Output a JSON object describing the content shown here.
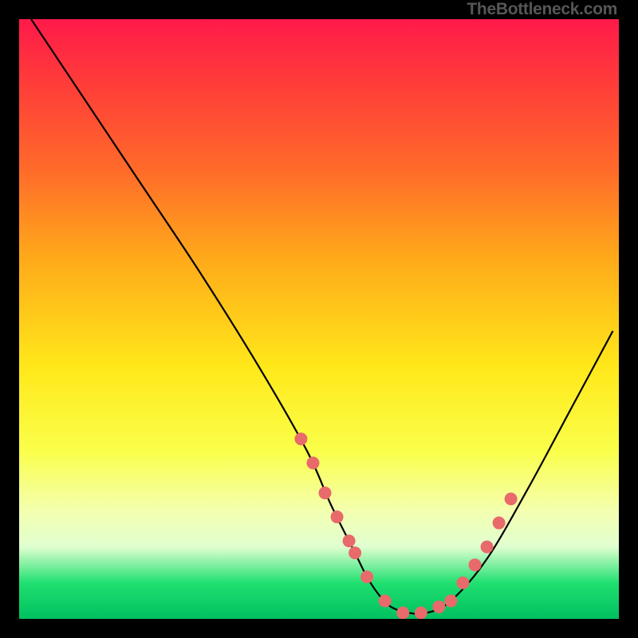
{
  "watermark": "TheBottleneck.com",
  "chart_data": {
    "type": "line",
    "title": "",
    "xlabel": "",
    "ylabel": "",
    "xlim": [
      0,
      100
    ],
    "ylim": [
      0,
      100
    ],
    "curve": {
      "name": "bottleneck-curve",
      "x": [
        2,
        10,
        20,
        30,
        40,
        48,
        52,
        56,
        58,
        60,
        62,
        65,
        68,
        72,
        78,
        85,
        92,
        99
      ],
      "y": [
        100,
        88,
        73,
        58,
        42,
        28,
        19,
        11,
        7,
        4,
        2,
        1,
        1,
        3,
        10,
        22,
        35,
        48
      ]
    },
    "markers": {
      "name": "highlight-dots",
      "color": "#e86a6a",
      "x": [
        47,
        49,
        51,
        53,
        55,
        56,
        58,
        61,
        64,
        67,
        70,
        72,
        74,
        76,
        78,
        80,
        82
      ],
      "y": [
        30,
        26,
        21,
        17,
        13,
        11,
        7,
        3,
        1,
        1,
        2,
        3,
        6,
        9,
        12,
        16,
        20
      ]
    }
  }
}
